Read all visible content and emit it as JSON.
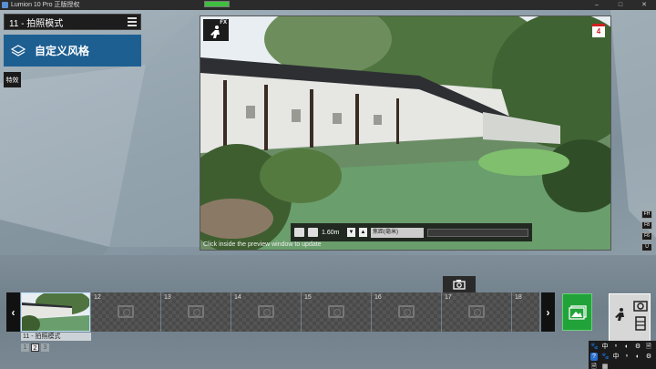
{
  "window": {
    "title": "Lumion 10 Pro 正版授权",
    "progress_fraction": 1.0,
    "buttons": [
      "–",
      "□",
      "✕"
    ]
  },
  "left_panel": {
    "mode_title": "11 - 拍照模式",
    "style_button_label": "自定义风格",
    "effects_label": "特效"
  },
  "preview": {
    "fx_badge": "FX",
    "calendar_value": "4",
    "camera_height": "1.60m",
    "focus_label": "焦距(毫米)",
    "hint": "Click inside the preview window to update",
    "colors": {
      "sky": "#e8eef2",
      "water": "#6a9e6c",
      "wall": "#e6e6e3",
      "roof": "#2e2f33"
    }
  },
  "side_buttons": [
    "FH",
    "F8",
    "F6",
    "U"
  ],
  "filmstrip": {
    "prev_arrow": "‹",
    "next_arrow": "›",
    "slots": [
      {
        "num": "",
        "active": true
      },
      {
        "num": "12",
        "active": false
      },
      {
        "num": "13",
        "active": false
      },
      {
        "num": "14",
        "active": false
      },
      {
        "num": "15",
        "active": false
      },
      {
        "num": "16",
        "active": false
      },
      {
        "num": "17",
        "active": false
      },
      {
        "num": "18",
        "active": false
      }
    ],
    "active_caption": "11 - 拍照模式",
    "pages": [
      "1",
      "2",
      "3"
    ],
    "current_page": "2"
  },
  "tray": {
    "items": [
      "🐾",
      "中",
      "ⁿ",
      "◐",
      "⚙",
      "🗎",
      "?",
      "🐾",
      "中",
      "ⁿ",
      "◐",
      "⚙",
      "🗎",
      "▦"
    ]
  },
  "accent_colors": {
    "style_button": "#1e5f92",
    "save_button": "#22a33a"
  }
}
